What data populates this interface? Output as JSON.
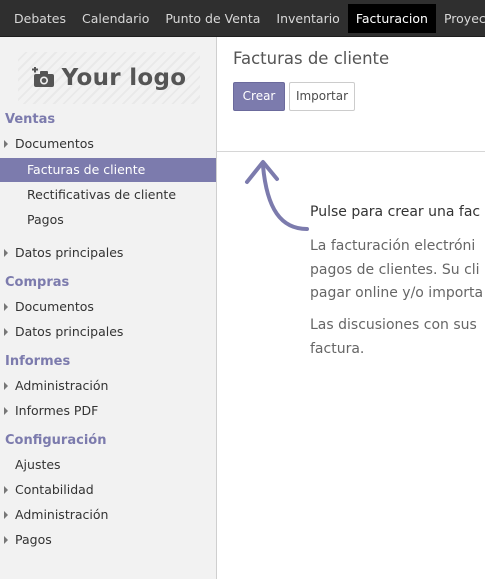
{
  "topnav": {
    "items": [
      {
        "label": "Debates"
      },
      {
        "label": "Calendario"
      },
      {
        "label": "Punto de Venta"
      },
      {
        "label": "Inventario"
      },
      {
        "label": "Facturacion",
        "active": true
      },
      {
        "label": "Proyecto"
      }
    ]
  },
  "sidebar": {
    "logo_text": "Your logo",
    "sections": {
      "ventas": "Ventas",
      "compras": "Compras",
      "informes": "Informes",
      "configuracion": "Configuración"
    },
    "items": {
      "ventas_documentos": "Documentos",
      "facturas_cliente": "Facturas de cliente",
      "rectificativas_cliente": "Rectificativas de cliente",
      "pagos_ventas": "Pagos",
      "ventas_datos_principales": "Datos principales",
      "compras_documentos": "Documentos",
      "compras_datos_principales": "Datos principales",
      "informes_administracion": "Administración",
      "informes_pdf": "Informes PDF",
      "ajustes": "Ajustes",
      "contabilidad": "Contabilidad",
      "config_administracion": "Administración",
      "config_pagos": "Pagos"
    }
  },
  "main": {
    "title": "Facturas de cliente",
    "create_label": "Crear",
    "import_label": "Importar",
    "help": {
      "title": "Pulse para crear una fac",
      "p1_lines": [
        "La facturación electróni",
        "pagos de clientes. Su cli",
        "pagar online y/o importa"
      ],
      "p2_lines": [
        "Las discusiones con sus",
        "factura."
      ]
    }
  },
  "colors": {
    "accent": "#7c7bad",
    "topbar": "#2f2f2f",
    "sidebar_bg": "#f2f2f2"
  }
}
